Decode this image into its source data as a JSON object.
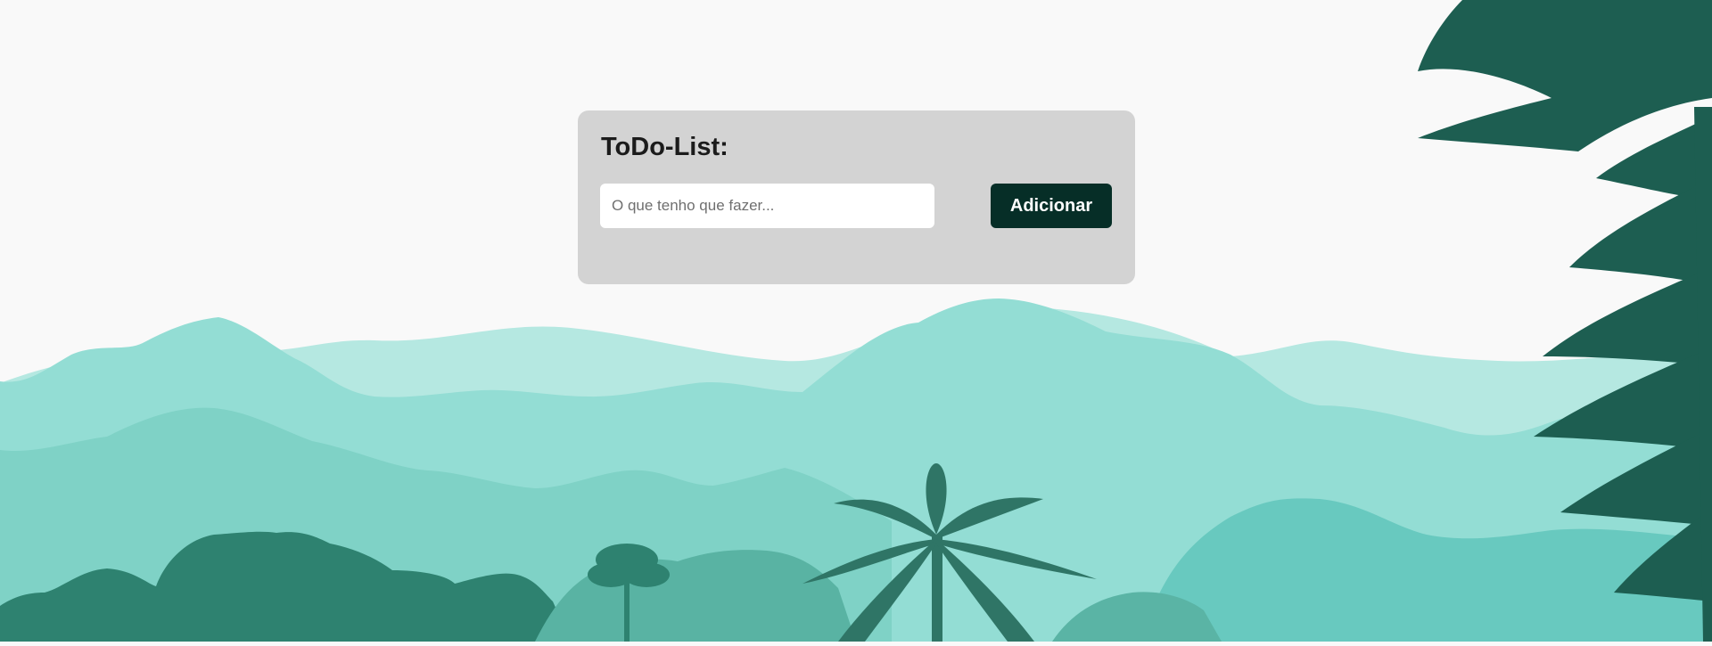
{
  "todo": {
    "title": "ToDo-List:",
    "input_value": "",
    "input_placeholder": "O que tenho que fazer...",
    "add_button_label": "Adicionar"
  },
  "theme": {
    "page_background": "#f9f9f9",
    "card_background": "#d3d3d3",
    "button_background": "#062e27",
    "mountain_light": "#b5e8e1",
    "mountain_mid": "#93ddd4",
    "mountain_deep": "#7fd2c6",
    "forest_dark": "#2e8270",
    "palm_dark": "#2f7566",
    "fern_dark": "#1d5e51"
  },
  "background": {
    "illustration": "jungle-landscape",
    "elements": [
      "mountains",
      "forest",
      "palm-tree",
      "fern-leaves"
    ]
  }
}
